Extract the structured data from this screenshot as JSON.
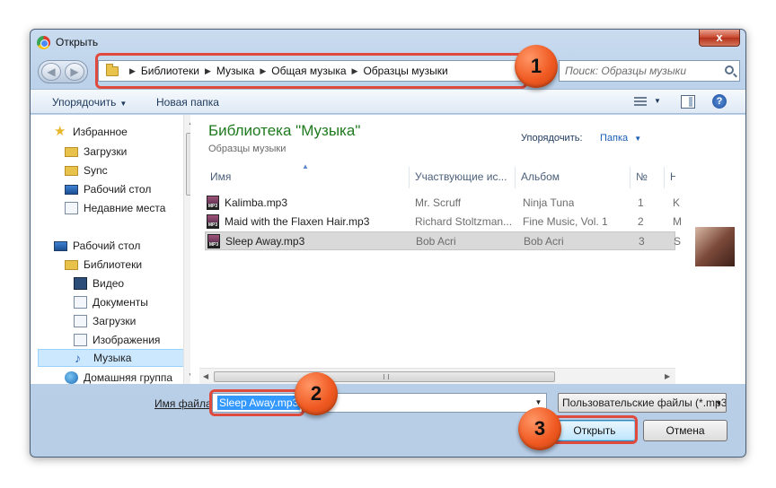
{
  "window": {
    "title": "Открыть",
    "close_label": "x"
  },
  "nav": {
    "back": "◀",
    "forward": "▶"
  },
  "address": {
    "crumbs": [
      "Библиотеки",
      "Музыка",
      "Общая музыка",
      "Образцы музыки"
    ],
    "separator": "▶"
  },
  "search": {
    "placeholder": "Поиск: Образцы музыки"
  },
  "toolbar": {
    "organize": "Упорядочить",
    "new_folder": "Новая папка",
    "help": "?"
  },
  "sidebar": {
    "items": [
      {
        "label": "Избранное",
        "icon": "star-icon"
      },
      {
        "label": "Загрузки",
        "icon": "folder-icon"
      },
      {
        "label": "Sync",
        "icon": "folder-icon"
      },
      {
        "label": "Рабочий стол",
        "icon": "monitor-icon"
      },
      {
        "label": "Недавние места",
        "icon": "recent-icon"
      },
      {
        "label": "Рабочий стол",
        "icon": "monitor-icon"
      },
      {
        "label": "Библиотеки",
        "icon": "library-icon"
      },
      {
        "label": "Видео",
        "icon": "video-icon"
      },
      {
        "label": "Документы",
        "icon": "document-icon"
      },
      {
        "label": "Загрузки",
        "icon": "download-icon"
      },
      {
        "label": "Изображения",
        "icon": "picture-icon"
      },
      {
        "label": "Музыка",
        "icon": "music-icon"
      },
      {
        "label": "Домашняя группа",
        "icon": "homegroup-icon"
      }
    ]
  },
  "library": {
    "title": "Библиотека \"Музыка\"",
    "subtitle": "Образцы музыки",
    "arrange_label": "Упорядочить:",
    "arrange_value": "Папка"
  },
  "columns": [
    "Имя",
    "Участвующие ис...",
    "Альбом",
    "№",
    "Н"
  ],
  "files": [
    {
      "name": "Kalimba.mp3",
      "artist": "Mr. Scruff",
      "album": "Ninja Tuna",
      "num": "1",
      "extra": "K"
    },
    {
      "name": "Maid with the Flaxen Hair.mp3",
      "artist": "Richard Stoltzman...",
      "album": "Fine Music, Vol. 1",
      "num": "2",
      "extra": "M"
    },
    {
      "name": "Sleep Away.mp3",
      "artist": "Bob Acri",
      "album": "Bob Acri",
      "num": "3",
      "extra": "S"
    }
  ],
  "footer": {
    "filename_label": "Имя файла:",
    "filename_value": "Sleep Away.mp3",
    "filetype": "Пользовательские файлы (*.mp3)",
    "open": "Открыть",
    "cancel": "Отмена"
  },
  "markers": [
    "1",
    "2",
    "3"
  ],
  "colors": {
    "callout": "#e04a3d",
    "marker": "#f05a22",
    "library_title": "#1e7a1e",
    "selection": "#3399ff"
  }
}
